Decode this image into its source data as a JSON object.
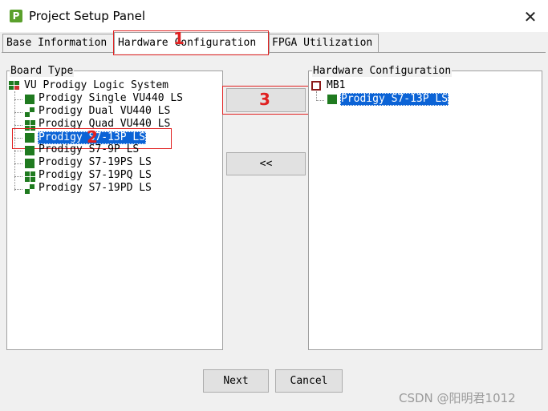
{
  "window": {
    "title": "Project Setup Panel",
    "icon": "P",
    "close_glyph": "✕"
  },
  "tabs": [
    {
      "label": "Base Information"
    },
    {
      "label": "Hardware Configuration"
    },
    {
      "label": "FPGA Utilization"
    }
  ],
  "board_type": {
    "title": "Board Type",
    "root": "VU Prodigy Logic System",
    "items": [
      "Prodigy Single VU440 LS",
      "Prodigy Dual VU440 LS",
      "Prodigy Quad VU440 LS",
      "Prodigy S7-13P LS",
      "Prodigy S7-9P LS",
      "Prodigy S7-19PS LS",
      "Prodigy S7-19PQ LS",
      "Prodigy S7-19PD LS"
    ]
  },
  "hardware_config": {
    "title": "Hardware Configuration",
    "root": "MB1",
    "items": [
      "Prodigy S7-13P LS"
    ]
  },
  "buttons": {
    "add": "",
    "remove": "<<",
    "next": "Next",
    "cancel": "Cancel"
  },
  "annotations": {
    "one": "1",
    "two": "2",
    "three": "3"
  },
  "watermark": "CSDN @阳明君1012",
  "colors": {
    "selection": "#0b63d6",
    "annotation": "#e02020",
    "board_icon": "#1f7a1f"
  }
}
